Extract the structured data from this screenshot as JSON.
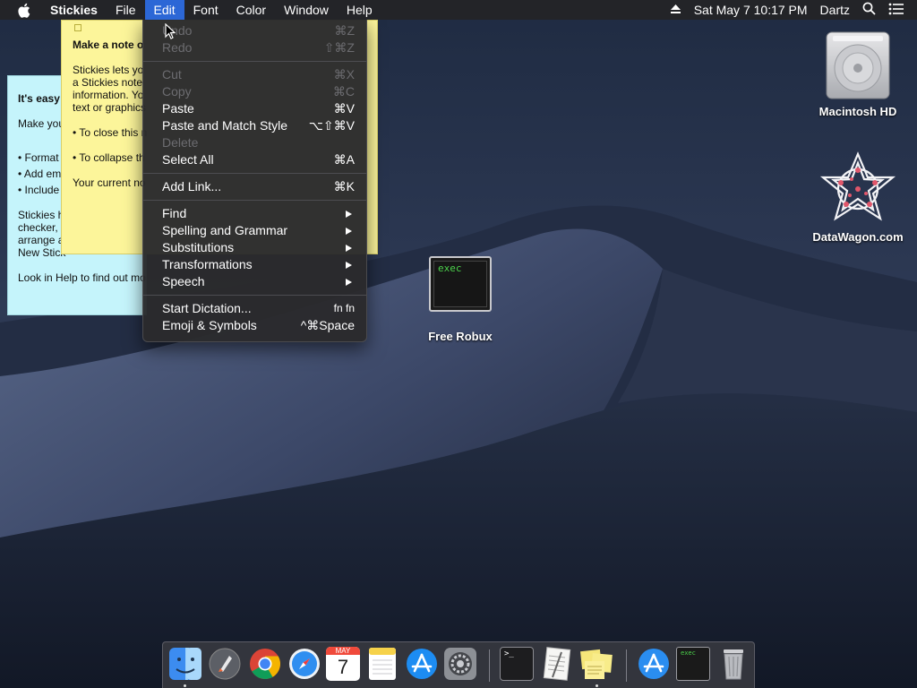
{
  "menubar": {
    "app_name": "Stickies",
    "menus": [
      "File",
      "Edit",
      "Font",
      "Color",
      "Window",
      "Help"
    ],
    "active_menu": "Edit",
    "clock": "Sat May 7  10:17 PM",
    "user": "Dartz",
    "icons": [
      "apple-icon",
      "eject-icon",
      "spotlight-icon",
      "notification-center-icon"
    ]
  },
  "edit_menu": {
    "items": [
      {
        "label": "Undo",
        "shortcut": "⌘Z",
        "disabled": true
      },
      {
        "label": "Redo",
        "shortcut": "⇧⌘Z",
        "disabled": true
      },
      {
        "label": "Cut",
        "shortcut": "⌘X",
        "disabled": true
      },
      {
        "label": "Copy",
        "shortcut": "⌘C",
        "disabled": true
      },
      {
        "label": "Paste",
        "shortcut": "⌘V",
        "disabled": false
      },
      {
        "label": "Paste and Match Style",
        "shortcut": "⌥⇧⌘V",
        "disabled": false
      },
      {
        "label": "Delete",
        "shortcut": "",
        "disabled": true
      },
      {
        "label": "Select All",
        "shortcut": "⌘A",
        "disabled": false
      },
      {
        "label": "Add Link...",
        "shortcut": "⌘K",
        "disabled": false
      },
      {
        "label": "Find",
        "submenu": true
      },
      {
        "label": "Spelling and Grammar",
        "submenu": true
      },
      {
        "label": "Substitutions",
        "submenu": true
      },
      {
        "label": "Transformations",
        "submenu": true
      },
      {
        "label": "Speech",
        "submenu": true
      },
      {
        "label": "Start Dictation...",
        "shortcut": "fn fn",
        "disabled": false
      },
      {
        "label": "Emoji & Symbols",
        "shortcut": "^⌘Space",
        "disabled": false
      }
    ]
  },
  "sticky_yellow": {
    "title": "Make a note o",
    "lines": [
      "Stickies lets yo",
      "a Stickies note",
      "information. Yo",
      "text or graphics"
    ],
    "bullet1": "• To close this n",
    "bullet2": "• To collapse th",
    "footer": "Your current no"
  },
  "sticky_blue": {
    "title": "It's easy",
    "intro": "Make you",
    "bullets": [
      "• Format",
      "• Add em",
      "• Include"
    ],
    "para": [
      "Stickies h",
      "checker,",
      "arrange a",
      "New Stick"
    ],
    "help": "Look in Help to find out mo"
  },
  "desktop": {
    "icons": [
      {
        "label": "Macintosh HD",
        "icon": "hard-drive-icon"
      },
      {
        "label": "DataWagon.com",
        "icon": "datawagon-logo-icon"
      },
      {
        "label": "Free Robux",
        "icon": "exec-file-icon",
        "thumb_text": "exec"
      }
    ]
  },
  "dock": {
    "apps": [
      "finder-icon",
      "launchpad-icon",
      "chrome-icon",
      "safari-icon",
      "calendar-icon",
      "notes-icon",
      "app-store-icon",
      "system-preferences-icon",
      "terminal-icon",
      "textedit-icon",
      "stickies-icon",
      "downloads-icon",
      "exec-file-icon",
      "trash-icon"
    ],
    "calendar_month": "MAY",
    "calendar_day": "7",
    "terminal_prompt": ">_",
    "exec_text": "exec"
  },
  "colors": {
    "menubar_bg": "#232428",
    "menu_highlight": "#2c67d6",
    "sticky_yellow": "#fcf59a",
    "sticky_blue": "#c5f4fb",
    "menu_bg": "#2a2a2c"
  }
}
